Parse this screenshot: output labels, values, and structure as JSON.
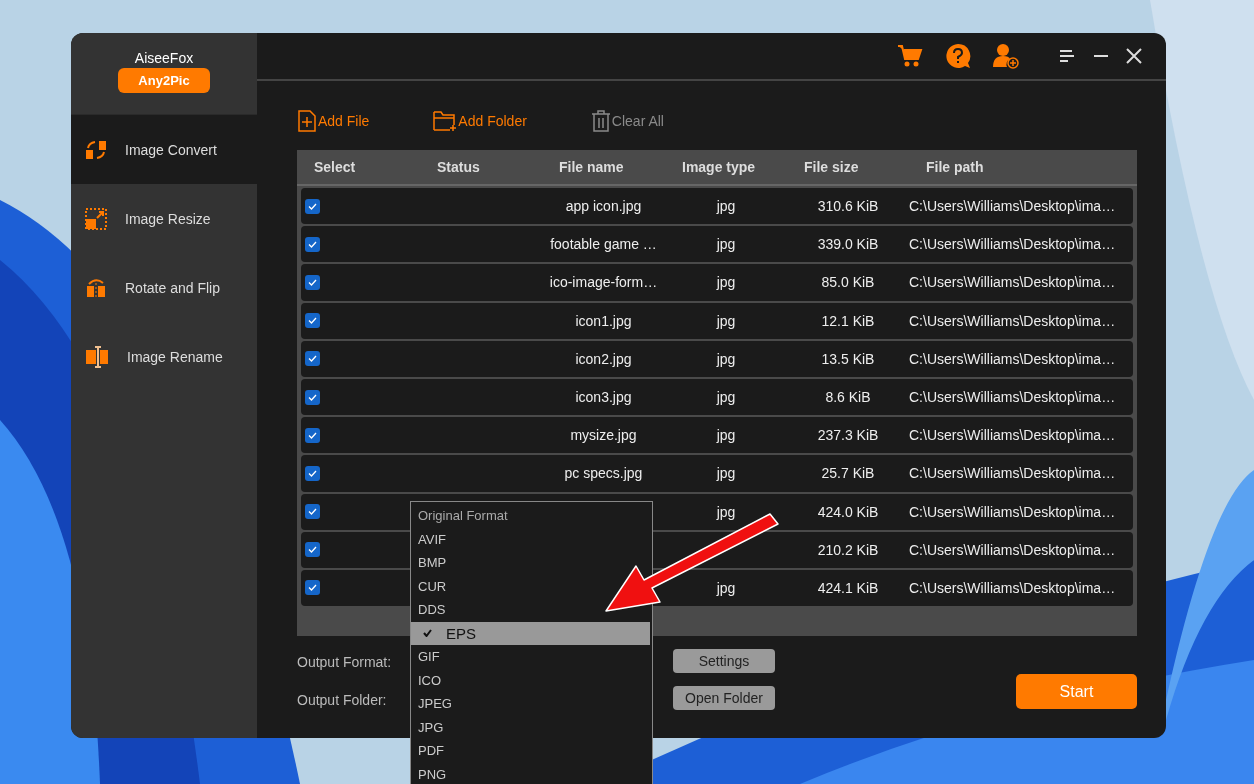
{
  "brand": {
    "name": "AiseeFox",
    "product": "Any2Pic"
  },
  "sidebar": {
    "items": [
      {
        "label": "Image Convert",
        "kind": "convert",
        "selected": true
      },
      {
        "label": "Image Resize",
        "kind": "resize",
        "selected": false
      },
      {
        "label": "Rotate and Flip",
        "kind": "rotate",
        "selected": false
      },
      {
        "label": "Image Rename",
        "kind": "rename",
        "selected": false
      }
    ]
  },
  "toolbar": [
    {
      "label": "Add File",
      "kind": "file",
      "disabled": false
    },
    {
      "label": "Add Folder",
      "kind": "folder",
      "disabled": false
    },
    {
      "label": "Clear All",
      "kind": "trash",
      "disabled": true
    }
  ],
  "table": {
    "columns": [
      "Select",
      "Status",
      "File name",
      "Image type",
      "File size",
      "File path"
    ],
    "rows": [
      {
        "checked": true,
        "file_name": "app icon.jpg",
        "image_type": "jpg",
        "file_size": "310.6 KiB",
        "file_path": "C:\\Users\\Williams\\Desktop\\ima…"
      },
      {
        "checked": true,
        "file_name": "footable game …",
        "image_type": "jpg",
        "file_size": "339.0 KiB",
        "file_path": "C:\\Users\\Williams\\Desktop\\ima…"
      },
      {
        "checked": true,
        "file_name": "ico-image-form…",
        "image_type": "jpg",
        "file_size": "85.0 KiB",
        "file_path": "C:\\Users\\Williams\\Desktop\\ima…"
      },
      {
        "checked": true,
        "file_name": "icon1.jpg",
        "image_type": "jpg",
        "file_size": "12.1 KiB",
        "file_path": "C:\\Users\\Williams\\Desktop\\ima…"
      },
      {
        "checked": true,
        "file_name": "icon2.jpg",
        "image_type": "jpg",
        "file_size": "13.5 KiB",
        "file_path": "C:\\Users\\Williams\\Desktop\\ima…"
      },
      {
        "checked": true,
        "file_name": "icon3.jpg",
        "image_type": "jpg",
        "file_size": "8.6 KiB",
        "file_path": "C:\\Users\\Williams\\Desktop\\ima…"
      },
      {
        "checked": true,
        "file_name": "mysize.jpg",
        "image_type": "jpg",
        "file_size": "237.3 KiB",
        "file_path": "C:\\Users\\Williams\\Desktop\\ima…"
      },
      {
        "checked": true,
        "file_name": "pc specs.jpg",
        "image_type": "jpg",
        "file_size": "25.7 KiB",
        "file_path": "C:\\Users\\Williams\\Desktop\\ima…"
      },
      {
        "checked": true,
        "image_type": "jpg",
        "file_size": "424.0 KiB",
        "file_path": "C:\\Users\\Williams\\Desktop\\ima…"
      },
      {
        "checked": true,
        "file_size": "210.2 KiB",
        "file_path": "C:\\Users\\Williams\\Desktop\\ima…"
      },
      {
        "checked": true,
        "image_type": "jpg",
        "file_size": "424.1 KiB",
        "file_path": "C:\\Users\\Williams\\Desktop\\ima…"
      }
    ]
  },
  "output": {
    "format_label": "Output Format:",
    "folder_label": "Output Folder:",
    "settings_button": "Settings",
    "open_folder_button": "Open Folder",
    "start_button": "Start"
  },
  "format_menu": [
    {
      "label": "Original Format",
      "selected": false,
      "disabled": true
    },
    {
      "label": "AVIF",
      "selected": false,
      "disabled": false
    },
    {
      "label": "BMP",
      "selected": false,
      "disabled": false
    },
    {
      "label": "CUR",
      "selected": false,
      "disabled": false
    },
    {
      "label": "DDS",
      "selected": false,
      "disabled": false
    },
    {
      "label": "EPS",
      "selected": true,
      "disabled": false
    },
    {
      "label": "GIF",
      "selected": false,
      "disabled": false
    },
    {
      "label": "ICO",
      "selected": false,
      "disabled": false
    },
    {
      "label": "JPEG",
      "selected": false,
      "disabled": false
    },
    {
      "label": "JPG",
      "selected": false,
      "disabled": false
    },
    {
      "label": "PDF",
      "selected": false,
      "disabled": false
    },
    {
      "label": "PNG",
      "selected": false,
      "disabled": false
    }
  ]
}
